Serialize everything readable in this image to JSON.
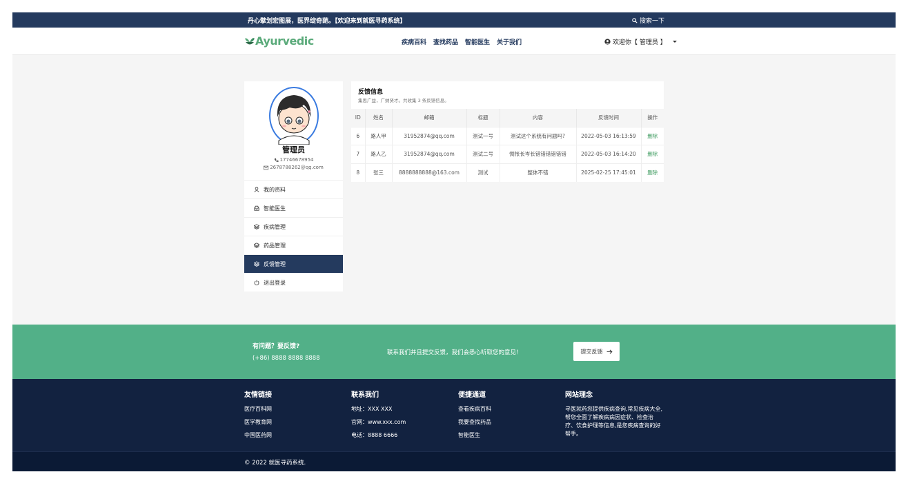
{
  "topbar": {
    "slogan": "丹心擘划宏图展，医界绽奇葩。【欢迎来到就医寻药系统】",
    "search_label": "搜索一下"
  },
  "header": {
    "logo_text": "Ayurvedic",
    "nav": [
      "疾病百科",
      "查找药品",
      "智能医生",
      "关于我们"
    ],
    "user_greeting": "欢迎你【 管理员 】"
  },
  "profile": {
    "name": "管理员",
    "phone": "17746678954",
    "email": "2678788262@qq.com"
  },
  "sidebar": {
    "items": [
      {
        "label": "我的资料",
        "icon": "user-icon",
        "active": false
      },
      {
        "label": "智能医生",
        "icon": "inbox-icon",
        "active": false
      },
      {
        "label": "疾病管理",
        "icon": "layers-icon",
        "active": false
      },
      {
        "label": "药品管理",
        "icon": "layers-icon",
        "active": false
      },
      {
        "label": "反馈管理",
        "icon": "layers-icon",
        "active": true
      },
      {
        "label": "退出登录",
        "icon": "power-icon",
        "active": false
      }
    ]
  },
  "feedback": {
    "title": "反馈信息",
    "subtitle": "集思广益，广纳贤才。共收集 3 条反馈信息。",
    "columns": [
      "ID",
      "姓名",
      "邮箱",
      "标题",
      "内容",
      "反馈时间",
      "操作"
    ],
    "rows": [
      {
        "id": "6",
        "name": "路人甲",
        "email": "31952874@qq.com",
        "title": "测试一号",
        "content": "测试这个系统有问题吗?",
        "time": "2022-05-03 16:13:59",
        "action": "删除"
      },
      {
        "id": "7",
        "name": "路人乙",
        "email": "31952874@qq.com",
        "title": "测试二号",
        "content": "惆怅长岑长错错错错错错",
        "time": "2022-05-03 16:14:20",
        "action": "删除"
      },
      {
        "id": "8",
        "name": "张三",
        "email": "8888888888@163.com",
        "title": "测试",
        "content": "整体不错",
        "time": "2025-02-25 17:45:01",
        "action": "删除"
      }
    ]
  },
  "band": {
    "question": "有问题？要反馈?",
    "phone": "(+86) 8888 8888 8888",
    "message": "联系我们并且提交反馈，我们会悉心听取您的意见！",
    "button": "提交反馈"
  },
  "footer": {
    "links": {
      "title": "友情链接",
      "items": [
        "医疗百科网",
        "医学教育网",
        "中国医药网"
      ]
    },
    "contact": {
      "title": "联系我们",
      "items": [
        "地址：XXX XXX",
        "官网：www.xxx.com",
        "电话：8888 6666"
      ]
    },
    "quick": {
      "title": "便捷通道",
      "items": [
        "查看疾病百科",
        "我要查找药品",
        "智能医生"
      ]
    },
    "philosophy": {
      "title": "网站理念",
      "text": "寻医就药您提供疾病查询,常见疾病大全,帮您全面了解疾病病因症状、检查治疗、饮食护理等信息,是您疾病查询的好帮手。"
    },
    "copyright": "© 2022 就医寻药系统."
  },
  "colors": {
    "primary": "#243a5e",
    "accent": "#52b088",
    "footer": "#122240"
  }
}
